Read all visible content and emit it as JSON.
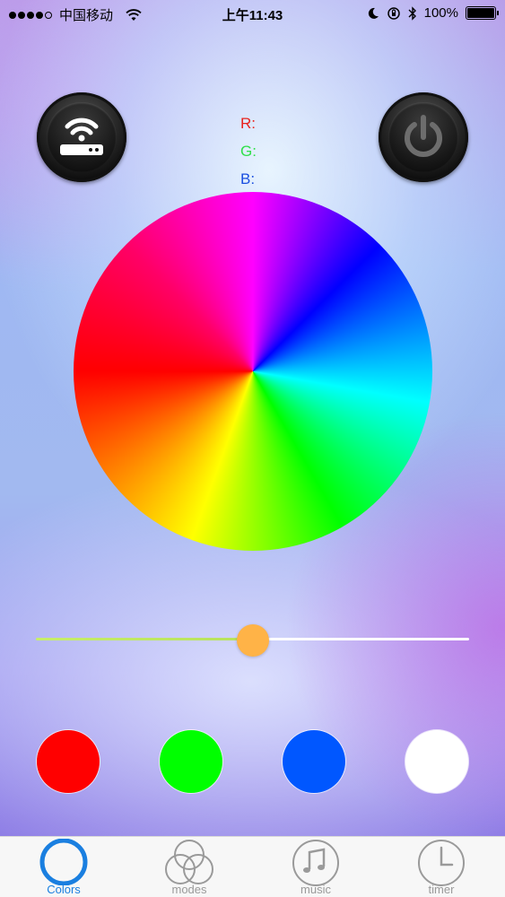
{
  "status_bar": {
    "carrier": "中国移动",
    "time": "上午11:43",
    "battery": "100%",
    "battery_level": 1.0
  },
  "header": {
    "wifi_button_icon": "wifi-router-icon",
    "power_button_icon": "power-icon"
  },
  "rgb": {
    "r_label": "R:",
    "g_label": "G:",
    "b_label": "B:"
  },
  "brightness": {
    "value": 0.5,
    "track_left_color": "#c7ee6a",
    "track_right_color": "#ffffff",
    "thumb_color": "#ffb347"
  },
  "presets": [
    {
      "name": "red",
      "color": "#ff0000"
    },
    {
      "name": "green",
      "color": "#00ff00"
    },
    {
      "name": "blue",
      "color": "#0057ff"
    },
    {
      "name": "white",
      "color": "#ffffff"
    }
  ],
  "tabs": [
    {
      "label": "Colors",
      "icon": "circle-icon",
      "active": true
    },
    {
      "label": "modes",
      "icon": "overlapping-circles-icon",
      "active": false
    },
    {
      "label": "music",
      "icon": "music-note-icon",
      "active": false
    },
    {
      "label": "timer",
      "icon": "clock-icon",
      "active": false
    }
  ],
  "colors": {
    "active_tab": "#1a7fe0",
    "inactive_tab": "#9a9a9a"
  }
}
